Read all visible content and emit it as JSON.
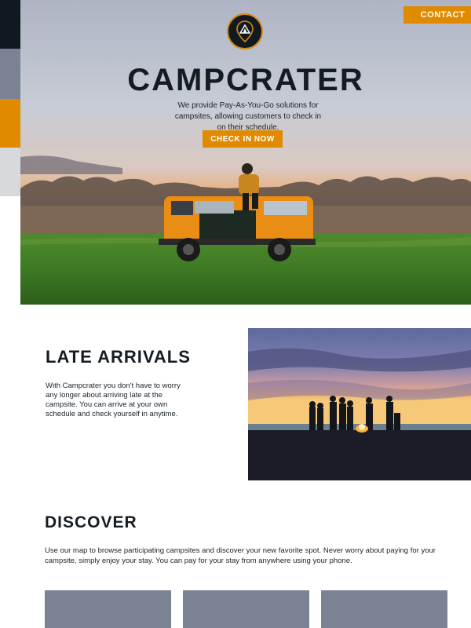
{
  "header": {
    "contact_label": "CONTACT",
    "logo_icon": "tent-pin-icon"
  },
  "hero": {
    "title": "CAMPCRATER",
    "subtitle": "We provide Pay-As-You-Go solutions for campsites, allowing customers to check in on their schedule.",
    "cta_label": "CHECK IN NOW",
    "image": "van-in-field-photo"
  },
  "late_arrivals": {
    "title": "LATE ARRIVALS",
    "text": "With Campcrater you don't have to worry any longer about arriving late at the campsite. You can arrive at your own schedule and check yourself in anytime.",
    "image": "campfire-beach-photo"
  },
  "discover": {
    "title": "DISCOVER",
    "text": "Use our map to browse participating campsites and discover your new favorite spot. Never worry about paying for your campsite, simply enjoy your stay. You can pay for your stay from anywhere using your phone."
  },
  "colors": {
    "accent": "#e08a00",
    "dark": "#0f1a20",
    "slate": "#7b8294",
    "light_gray": "#d8d9dc"
  }
}
